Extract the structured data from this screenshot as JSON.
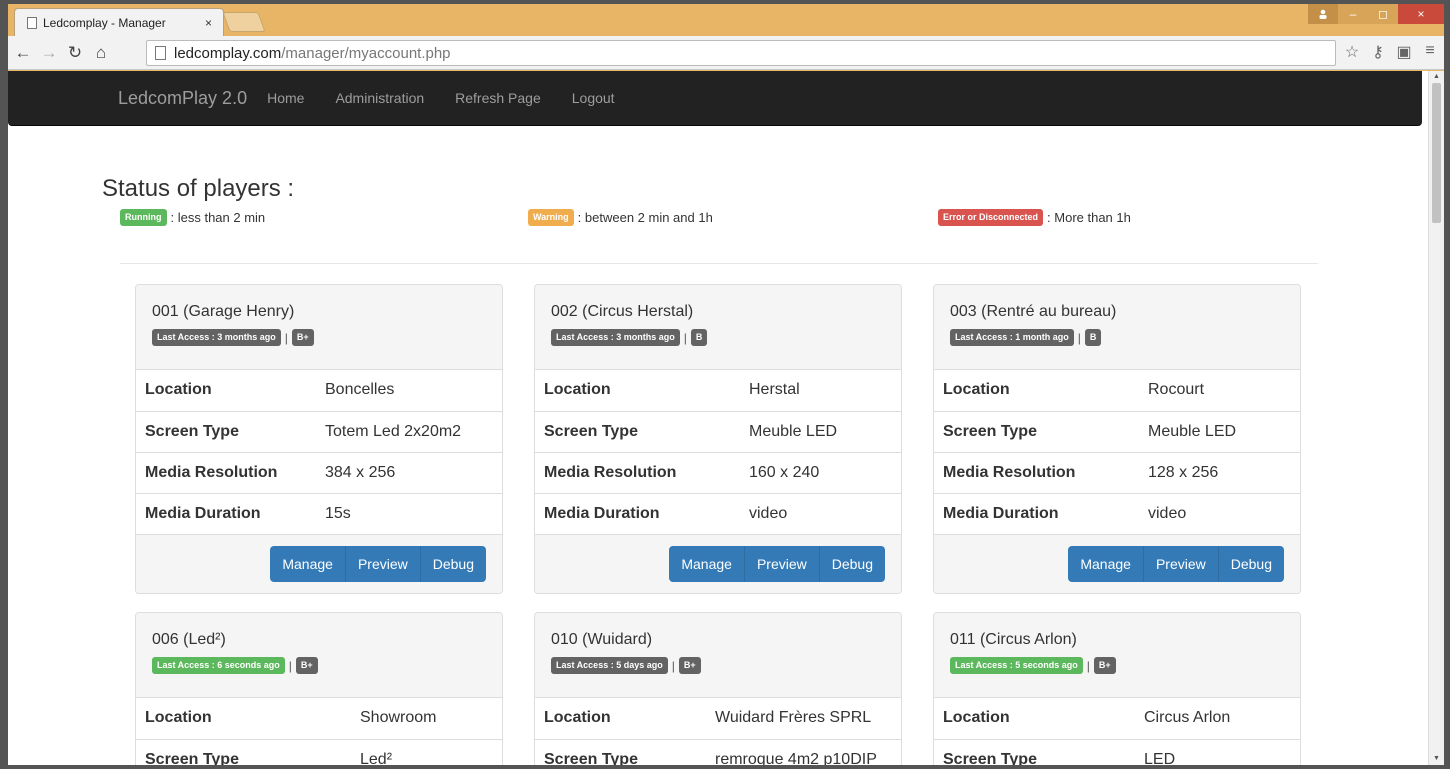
{
  "browser": {
    "tab_title": "Ledcomplay - Manager",
    "tab_close": "×",
    "url_host": "ledcomplay.com",
    "url_path": "/manager/myaccount.php",
    "win_min": "–",
    "win_max": "◻",
    "win_close": "×"
  },
  "navbar": {
    "brand": "LedcomPlay 2.0",
    "links": [
      "Home",
      "Administration",
      "Refresh Page",
      "Logout"
    ]
  },
  "page": {
    "title": "Status of players :",
    "legend": [
      {
        "badge": "Running",
        "text": ": less than 2 min",
        "color": "#5cb85c"
      },
      {
        "badge": "Warning",
        "text": ": between 2 min and 1h",
        "color": "#f0ad4e"
      },
      {
        "badge": "Error or Disconnected",
        "text": ": More than 1h",
        "color": "#d9534f"
      }
    ]
  },
  "labels": {
    "location": "Location",
    "screen_type": "Screen Type",
    "media_resolution": "Media Resolution",
    "media_duration": "Media Duration",
    "manage": "Manage",
    "preview": "Preview",
    "debug": "Debug",
    "separator": "|"
  },
  "players": [
    {
      "title": "001 (Garage Henry)",
      "access": "Last Access : 3 months ago",
      "status": "default",
      "grade": "B+",
      "location": "Boncelles",
      "screen_type": "Totem Led 2x20m2",
      "resolution": "384 x 256",
      "duration": "15s"
    },
    {
      "title": "002 (Circus Herstal)",
      "access": "Last Access : 3 months ago",
      "status": "default",
      "grade": "B",
      "location": "Herstal",
      "screen_type": "Meuble LED",
      "resolution": "160 x 240",
      "duration": "video"
    },
    {
      "title": "003 (Rentré au bureau)",
      "access": "Last Access : 1 month ago",
      "status": "default",
      "grade": "B",
      "location": "Rocourt",
      "screen_type": "Meuble LED",
      "resolution": "128 x 256",
      "duration": "video"
    },
    {
      "title": "006 (Led²)",
      "access": "Last Access : 6 seconds ago",
      "status": "success",
      "grade": "B+",
      "location": "Showroom",
      "screen_type": "Led²"
    },
    {
      "title": "010 (Wuidard)",
      "access": "Last Access : 5 days ago",
      "status": "default",
      "grade": "B+",
      "location": "Wuidard Frères SPRL",
      "screen_type": "remroque 4m2 p10DIP"
    },
    {
      "title": "011 (Circus Arlon)",
      "access": "Last Access : 5 seconds ago",
      "status": "success",
      "grade": "B+",
      "location": "Circus Arlon",
      "screen_type": "LED"
    }
  ]
}
